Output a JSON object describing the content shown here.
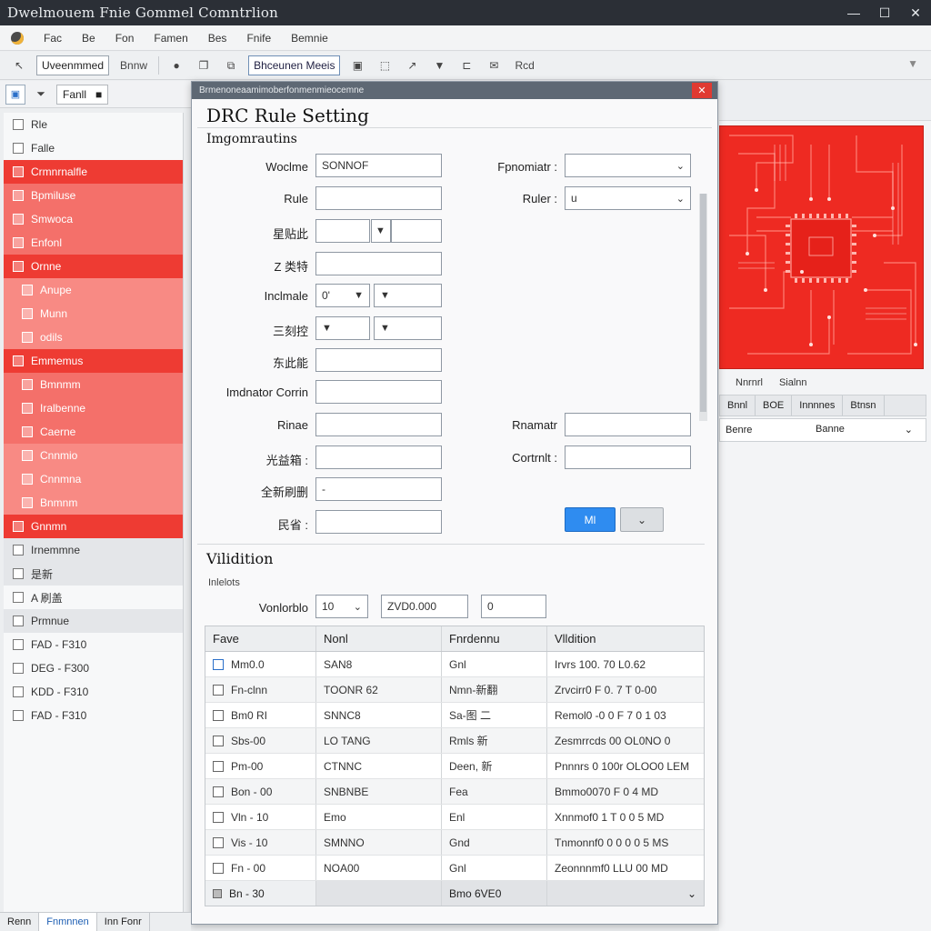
{
  "window": {
    "title": "Dwelmouem Fnie Gommel Comntrlion"
  },
  "menu": [
    "Fac",
    "Be",
    "Fon",
    "Famen",
    "Bes",
    "Fnife",
    "Bemnie"
  ],
  "toolbar": {
    "dropdown1": "Uveenmmed",
    "label1": "Bnnw",
    "dropdown2": "Bhceunen Meeis",
    "label2": "Rcd"
  },
  "toolbar2": {
    "field1": "Fanll"
  },
  "sidebar": {
    "items": [
      {
        "label": "Rle",
        "style": "plain",
        "level": 0
      },
      {
        "label": "Falle",
        "style": "plain",
        "level": 0
      },
      {
        "label": "Crmnrnalfle",
        "style": "red",
        "level": 0
      },
      {
        "label": "Bpmiluse",
        "style": "pink",
        "level": 0
      },
      {
        "label": "Smwoca",
        "style": "pink",
        "level": 0
      },
      {
        "label": "Enfonl",
        "style": "pink",
        "level": 0
      },
      {
        "label": "Ornne",
        "style": "red",
        "level": 0
      },
      {
        "label": "Anupe",
        "style": "pink2",
        "level": 1
      },
      {
        "label": "Munn",
        "style": "pink2",
        "level": 1
      },
      {
        "label": "odils",
        "style": "pink2",
        "level": 1
      },
      {
        "label": "Emmemus",
        "style": "red",
        "level": 0
      },
      {
        "label": "Bmnmm",
        "style": "pink",
        "level": 1
      },
      {
        "label": "Iralbenne",
        "style": "pink",
        "level": 1
      },
      {
        "label": "Caerne",
        "style": "pink",
        "level": 1
      },
      {
        "label": "Cnnmio",
        "style": "pink2",
        "level": 1
      },
      {
        "label": "Cnnmna",
        "style": "pink2",
        "level": 1
      },
      {
        "label": "Bnmnm",
        "style": "pink2",
        "level": 1
      },
      {
        "label": "Gnnmn",
        "style": "red",
        "level": 0
      },
      {
        "label": "Irnemmne",
        "style": "gray",
        "level": 0
      },
      {
        "label": "是新",
        "style": "gray",
        "level": 0
      },
      {
        "label": "A 刷盖",
        "style": "plain",
        "level": 0
      },
      {
        "label": "Prmnue",
        "style": "gray",
        "level": 0
      },
      {
        "label": "FAD - F310",
        "style": "plain",
        "level": 0
      },
      {
        "label": "DEG - F300",
        "style": "plain",
        "level": 0
      },
      {
        "label": "KDD - F310",
        "style": "plain",
        "level": 0
      },
      {
        "label": "FAD - F310",
        "style": "plain",
        "level": 0
      }
    ]
  },
  "dialog": {
    "titlebar": "Brmenoneaamimoberfonmenmieocemne",
    "heading": "DRC Rule Setting",
    "section1": "Imgomrautins",
    "fields": {
      "name_label": "Woclme",
      "name_value": "SONNOF",
      "rule_label": "Rule",
      "rule_value": "",
      "row3_label": "星贴此",
      "row3_value2": "",
      "row4_label": "Z 类特",
      "row4_value": "",
      "include_label": "Inclmale",
      "include_value": "0'",
      "include_value2": "",
      "row6_label": "三刻控",
      "row7_label": "东此能",
      "row7_value": "",
      "inductor_label": "Imdnator Corrin",
      "inductor_value": "",
      "rinae_label": "Rinae",
      "rinae_value": "",
      "row10_label": "光益箱 :",
      "row10_value": "",
      "row11_label": "全新刷删",
      "row11_value": "-",
      "row12_label": "民省 :",
      "row12_value": "",
      "param_label": "Fpnomiatr :",
      "param_value": "",
      "rules_label": "Ruler :",
      "rules_value": "u",
      "rmaer_label": "Rnamatr",
      "rmaer_value": "",
      "contrl_label": "Cortrnlt :",
      "contrl_value": ""
    },
    "ok_button": "Ml",
    "more_button": "",
    "section2": "Vilidition",
    "sub_label": "Inlelots",
    "validate_label": "Vonlorblo",
    "validate_select": "10",
    "validate_value": "ZVD0.000",
    "validate_small": "0",
    "grid": {
      "columns": [
        "Fave",
        "Nonl",
        "Fnrdennu",
        "Vlldition"
      ],
      "rows": [
        [
          "Mm0.0",
          "SAN8",
          "Gnl",
          "Irvrs 100. 70 L0.62"
        ],
        [
          "Fn-clnn",
          "TOONR 62",
          "Nmn-新翻",
          "Zrvcirr0 F 0. 7 T 0-00"
        ],
        [
          "Bm0 RI",
          "SNNC8",
          "Sa-图 二",
          "Remol0 -0 0 F 7 0 1 03"
        ],
        [
          "Sbs-00",
          "LO TANG",
          "Rmls 新",
          "Zesmrrcds 00 OL0NO 0"
        ],
        [
          "Pm-00",
          "CTNNC",
          "Deen, 新",
          "Pnnnrs 0 100r OLOO0 LEM"
        ],
        [
          "Bon - 00",
          "SNBNBE",
          "Fea",
          "Bmmo0070 F 0 4 MD"
        ],
        [
          "Vln - 10",
          "Emo",
          "Enl",
          "Xnnmof0 1 T 0 0 5 MD"
        ],
        [
          "Vis - 10",
          "SMNNO",
          "Gnd",
          "Tnmonnf0 0 0 0 0 5 MS"
        ],
        [
          "Fn - 00",
          "NOA00",
          "Gnl",
          "Zeonnnmf0 LLU 00 MD"
        ]
      ],
      "footer": [
        "Bn - 30",
        "",
        "Bmo 6VE0",
        ""
      ]
    }
  },
  "right_panel": {
    "tabs": [
      "Nnrnrl",
      "Sialnn"
    ],
    "tabbar": [
      "Bnnl",
      "BOE",
      "Innnnes",
      "Btnsn"
    ],
    "row_label": "Benre",
    "row_value": "Banne"
  },
  "statusbar": [
    "Renn",
    "Fnmnnen",
    "Inn Fonr"
  ],
  "colors": {
    "accent_red": "#ee3b33",
    "primary_blue": "#2f8cf0",
    "titlebar": "#2b2f36"
  }
}
